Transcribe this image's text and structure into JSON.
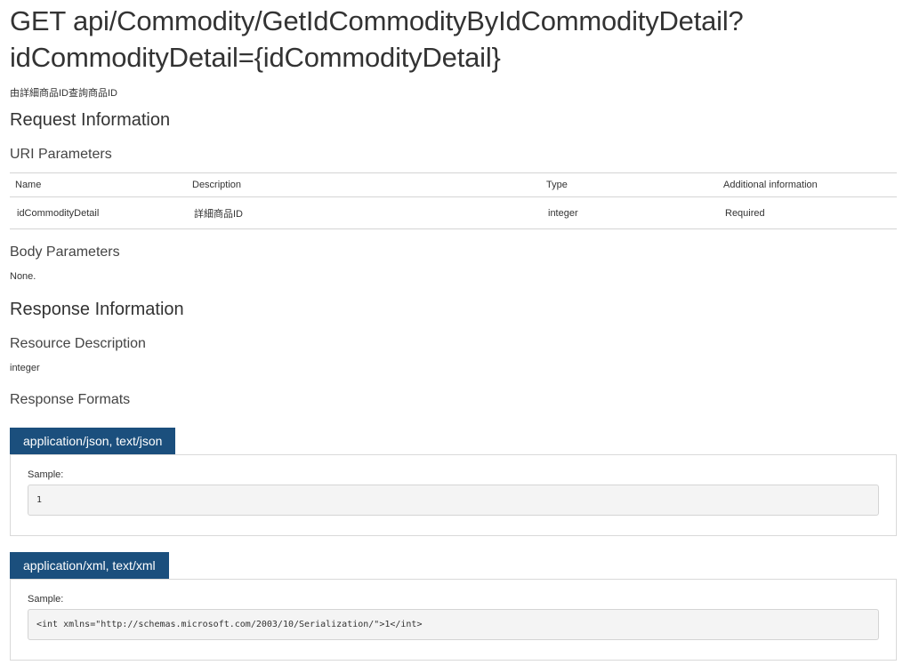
{
  "title": {
    "line1": "GET api/Commodity/GetIdCommodityByIdCommodityDetail?",
    "line2": "idCommodityDetail={idCommodityDetail}"
  },
  "description": "由詳細商品ID查詢商品ID",
  "request": {
    "heading": "Request Information",
    "uri_params": {
      "heading": "URI Parameters",
      "columns": [
        "Name",
        "Description",
        "Type",
        "Additional information"
      ],
      "rows": [
        [
          "idCommodityDetail",
          "詳細商品ID",
          "integer",
          "Required"
        ]
      ]
    },
    "body_params": {
      "heading": "Body Parameters",
      "value": "None."
    }
  },
  "response": {
    "heading": "Response Information",
    "resource_description": {
      "heading": "Resource Description",
      "value": "integer"
    },
    "formats": {
      "heading": "Response Formats",
      "items": [
        {
          "tab": "application/json, text/json",
          "sample_label": "Sample:",
          "sample": "1"
        },
        {
          "tab": "application/xml, text/xml",
          "sample_label": "Sample:",
          "sample": "<int xmlns=\"http://schemas.microsoft.com/2003/10/Serialization/\">1</int>"
        }
      ]
    }
  },
  "colors": {
    "tab_background": "#1b4f7d",
    "tab_text": "#ffffff",
    "sample_background": "#f4f4f4",
    "border": "#d4d4d4"
  }
}
